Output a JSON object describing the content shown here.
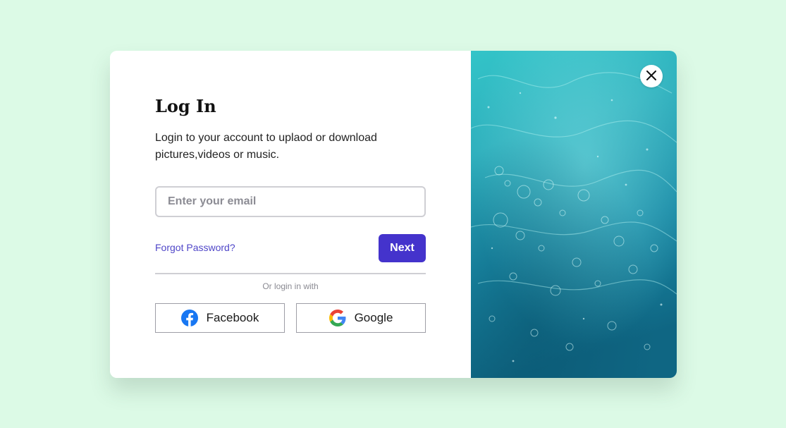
{
  "theme": {
    "background": "#dcfae6",
    "accent": "#4433cc",
    "link_color": "#4f46c8"
  },
  "login": {
    "title": "Log In",
    "subtitle": "Login to your account to uplaod or download pictures,videos or music.",
    "email_placeholder": "Enter your email",
    "email_value": "",
    "forgot_password_label": "Forgot Password?",
    "next_label": "Next",
    "divider_text": "Or login in with"
  },
  "social": {
    "facebook_label": "Facebook",
    "facebook_icon": "facebook-icon",
    "google_label": "Google",
    "google_icon": "google-icon"
  },
  "close_icon": "close-icon"
}
